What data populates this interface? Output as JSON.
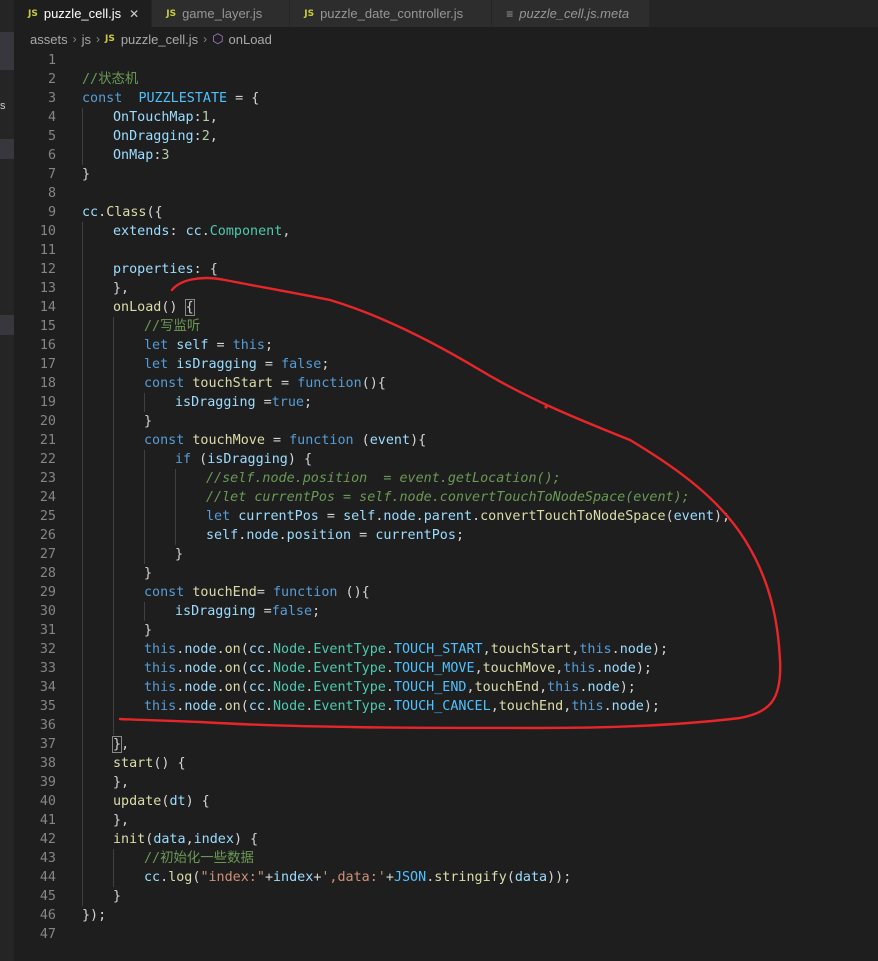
{
  "tabs": [
    {
      "label": "puzzle_cell.js",
      "badge": "JS",
      "active": true,
      "close": "✕"
    },
    {
      "label": "game_layer.js",
      "badge": "JS"
    },
    {
      "label": "puzzle_date_controller.js",
      "badge": "JS"
    },
    {
      "label": "puzzle_cell.js.meta",
      "italic": true
    }
  ],
  "breadcrumb": {
    "folder1": "assets",
    "folder2": "js",
    "badge": "JS",
    "file": "puzzle_cell.js",
    "symbol": "onLoad"
  },
  "annotation": {
    "color": "#e8262a"
  },
  "lines": [
    {
      "n": "1",
      "tokens": []
    },
    {
      "n": "2",
      "tokens": [
        [
          "cmt",
          "//状态机"
        ]
      ]
    },
    {
      "n": "3",
      "tokens": [
        [
          "kw",
          "const"
        ],
        [
          "",
          "  "
        ],
        [
          "cst",
          "PUZZLESTATE"
        ],
        [
          "",
          " = {"
        ]
      ]
    },
    {
      "n": "4",
      "indent": 1,
      "tokens": [
        [
          "var",
          "OnTouchMap"
        ],
        [
          "",
          ":"
        ],
        [
          "num",
          "1"
        ],
        [
          "",
          ","
        ]
      ]
    },
    {
      "n": "5",
      "indent": 1,
      "tokens": [
        [
          "var",
          "OnDragging"
        ],
        [
          "",
          ":"
        ],
        [
          "num",
          "2"
        ],
        [
          "",
          ","
        ]
      ]
    },
    {
      "n": "6",
      "indent": 1,
      "tokens": [
        [
          "var",
          "OnMap"
        ],
        [
          "",
          ":"
        ],
        [
          "num",
          "3"
        ]
      ]
    },
    {
      "n": "7",
      "tokens": [
        [
          "",
          "}"
        ]
      ]
    },
    {
      "n": "8",
      "tokens": []
    },
    {
      "n": "9",
      "tokens": [
        [
          "var",
          "cc"
        ],
        [
          "",
          "."
        ],
        [
          "fn",
          "Class"
        ],
        [
          "",
          "({"
        ]
      ]
    },
    {
      "n": "10",
      "indent": 1,
      "tokens": [
        [
          "var",
          "extends"
        ],
        [
          "",
          ": "
        ],
        [
          "var",
          "cc"
        ],
        [
          "",
          "."
        ],
        [
          "cls",
          "Component"
        ],
        [
          "",
          ","
        ]
      ]
    },
    {
      "n": "11",
      "indent": 1,
      "tokens": []
    },
    {
      "n": "12",
      "indent": 1,
      "tokens": [
        [
          "var",
          "properties"
        ],
        [
          "",
          ": {"
        ]
      ]
    },
    {
      "n": "13",
      "indent": 1,
      "tokens": [
        [
          "",
          "},"
        ]
      ]
    },
    {
      "n": "14",
      "indent": 1,
      "tokens": [
        [
          "fn",
          "onLoad"
        ],
        [
          "",
          "() "
        ],
        [
          "hl",
          "{"
        ]
      ]
    },
    {
      "n": "15",
      "indent": 2,
      "tokens": [
        [
          "cmt",
          "//写监听"
        ]
      ]
    },
    {
      "n": "16",
      "indent": 2,
      "tokens": [
        [
          "kw",
          "let"
        ],
        [
          "",
          " "
        ],
        [
          "var",
          "self"
        ],
        [
          "",
          " = "
        ],
        [
          "kw",
          "this"
        ],
        [
          "",
          ";"
        ]
      ]
    },
    {
      "n": "17",
      "indent": 2,
      "tokens": [
        [
          "kw",
          "let"
        ],
        [
          "",
          " "
        ],
        [
          "var",
          "isDragging"
        ],
        [
          "",
          " = "
        ],
        [
          "kw",
          "false"
        ],
        [
          "",
          ";"
        ]
      ]
    },
    {
      "n": "18",
      "indent": 2,
      "tokens": [
        [
          "kw",
          "const"
        ],
        [
          "",
          " "
        ],
        [
          "fn",
          "touchStart"
        ],
        [
          "",
          " = "
        ],
        [
          "kw",
          "function"
        ],
        [
          "",
          "(){"
        ]
      ]
    },
    {
      "n": "19",
      "indent": 3,
      "tokens": [
        [
          "var",
          "isDragging"
        ],
        [
          "",
          " ="
        ],
        [
          "kw",
          "true"
        ],
        [
          "",
          ";"
        ]
      ]
    },
    {
      "n": "20",
      "indent": 2,
      "tokens": [
        [
          "",
          "}"
        ]
      ]
    },
    {
      "n": "21",
      "indent": 2,
      "tokens": [
        [
          "kw",
          "const"
        ],
        [
          "",
          " "
        ],
        [
          "fn",
          "touchMove"
        ],
        [
          "",
          " = "
        ],
        [
          "kw",
          "function"
        ],
        [
          "",
          " ("
        ],
        [
          "var",
          "event"
        ],
        [
          "",
          "){"
        ]
      ]
    },
    {
      "n": "22",
      "indent": 3,
      "tokens": [
        [
          "kw",
          "if"
        ],
        [
          "",
          " ("
        ],
        [
          "var",
          "isDragging"
        ],
        [
          "",
          ") {"
        ]
      ]
    },
    {
      "n": "23",
      "indent": 4,
      "tokens": [
        [
          "cmt ital",
          "//self.node.position  = event.getLocation();"
        ]
      ]
    },
    {
      "n": "24",
      "indent": 4,
      "tokens": [
        [
          "cmt ital",
          "//let currentPos = self.node.convertTouchToNodeSpace(event);"
        ]
      ]
    },
    {
      "n": "25",
      "indent": 4,
      "tokens": [
        [
          "kw",
          "let"
        ],
        [
          "",
          " "
        ],
        [
          "var",
          "currentPos"
        ],
        [
          "",
          " = "
        ],
        [
          "var",
          "self"
        ],
        [
          "",
          "."
        ],
        [
          "var",
          "node"
        ],
        [
          "",
          "."
        ],
        [
          "var",
          "parent"
        ],
        [
          "",
          "."
        ],
        [
          "fn",
          "convertTouchToNodeSpace"
        ],
        [
          "",
          "("
        ],
        [
          "var",
          "event"
        ],
        [
          "",
          ");"
        ]
      ]
    },
    {
      "n": "26",
      "indent": 4,
      "tokens": [
        [
          "var",
          "self"
        ],
        [
          "",
          "."
        ],
        [
          "var",
          "node"
        ],
        [
          "",
          "."
        ],
        [
          "var",
          "position"
        ],
        [
          "",
          " = "
        ],
        [
          "var",
          "currentPos"
        ],
        [
          "",
          ";"
        ]
      ]
    },
    {
      "n": "27",
      "indent": 3,
      "tokens": [
        [
          "",
          "}"
        ]
      ]
    },
    {
      "n": "28",
      "indent": 2,
      "tokens": [
        [
          "",
          "}"
        ]
      ]
    },
    {
      "n": "29",
      "indent": 2,
      "tokens": [
        [
          "kw",
          "const"
        ],
        [
          "",
          " "
        ],
        [
          "fn",
          "touchEnd"
        ],
        [
          "",
          "= "
        ],
        [
          "kw",
          "function"
        ],
        [
          "",
          " (){"
        ]
      ]
    },
    {
      "n": "30",
      "indent": 3,
      "tokens": [
        [
          "var",
          "isDragging"
        ],
        [
          "",
          " ="
        ],
        [
          "kw",
          "false"
        ],
        [
          "",
          ";"
        ]
      ]
    },
    {
      "n": "31",
      "indent": 2,
      "tokens": [
        [
          "",
          "}"
        ]
      ]
    },
    {
      "n": "32",
      "indent": 2,
      "tokens": [
        [
          "kw",
          "this"
        ],
        [
          "",
          "."
        ],
        [
          "var",
          "node"
        ],
        [
          "",
          "."
        ],
        [
          "fn",
          "on"
        ],
        [
          "",
          "("
        ],
        [
          "var",
          "cc"
        ],
        [
          "",
          "."
        ],
        [
          "cls",
          "Node"
        ],
        [
          "",
          "."
        ],
        [
          "cls",
          "EventType"
        ],
        [
          "",
          "."
        ],
        [
          "cst",
          "TOUCH_START"
        ],
        [
          "",
          ","
        ],
        [
          "fn",
          "touchStart"
        ],
        [
          "",
          ","
        ],
        [
          "kw",
          "this"
        ],
        [
          "",
          "."
        ],
        [
          "var",
          "node"
        ],
        [
          "",
          ");"
        ]
      ]
    },
    {
      "n": "33",
      "indent": 2,
      "tokens": [
        [
          "kw",
          "this"
        ],
        [
          "",
          "."
        ],
        [
          "var",
          "node"
        ],
        [
          "",
          "."
        ],
        [
          "fn",
          "on"
        ],
        [
          "",
          "("
        ],
        [
          "var",
          "cc"
        ],
        [
          "",
          "."
        ],
        [
          "cls",
          "Node"
        ],
        [
          "",
          "."
        ],
        [
          "cls",
          "EventType"
        ],
        [
          "",
          "."
        ],
        [
          "cst",
          "TOUCH_MOVE"
        ],
        [
          "",
          ","
        ],
        [
          "fn",
          "touchMove"
        ],
        [
          "",
          ","
        ],
        [
          "kw",
          "this"
        ],
        [
          "",
          "."
        ],
        [
          "var",
          "node"
        ],
        [
          "",
          ");"
        ]
      ]
    },
    {
      "n": "34",
      "indent": 2,
      "tokens": [
        [
          "kw",
          "this"
        ],
        [
          "",
          "."
        ],
        [
          "var",
          "node"
        ],
        [
          "",
          "."
        ],
        [
          "fn",
          "on"
        ],
        [
          "",
          "("
        ],
        [
          "var",
          "cc"
        ],
        [
          "",
          "."
        ],
        [
          "cls",
          "Node"
        ],
        [
          "",
          "."
        ],
        [
          "cls",
          "EventType"
        ],
        [
          "",
          "."
        ],
        [
          "cst",
          "TOUCH_END"
        ],
        [
          "",
          ","
        ],
        [
          "fn",
          "touchEnd"
        ],
        [
          "",
          ","
        ],
        [
          "kw",
          "this"
        ],
        [
          "",
          "."
        ],
        [
          "var",
          "node"
        ],
        [
          "",
          ");"
        ]
      ]
    },
    {
      "n": "35",
      "indent": 2,
      "tokens": [
        [
          "kw",
          "this"
        ],
        [
          "",
          "."
        ],
        [
          "var",
          "node"
        ],
        [
          "",
          "."
        ],
        [
          "fn",
          "on"
        ],
        [
          "",
          "("
        ],
        [
          "var",
          "cc"
        ],
        [
          "",
          "."
        ],
        [
          "cls",
          "Node"
        ],
        [
          "",
          "."
        ],
        [
          "cls",
          "EventType"
        ],
        [
          "",
          "."
        ],
        [
          "cst",
          "TOUCH_CANCEL"
        ],
        [
          "",
          ","
        ],
        [
          "fn",
          "touchEnd"
        ],
        [
          "",
          ","
        ],
        [
          "kw",
          "this"
        ],
        [
          "",
          "."
        ],
        [
          "var",
          "node"
        ],
        [
          "",
          ");"
        ]
      ]
    },
    {
      "n": "36",
      "indent": 2,
      "tokens": []
    },
    {
      "n": "37",
      "indent": 1,
      "tokens": [
        [
          "hl",
          "}"
        ],
        [
          "",
          ","
        ]
      ]
    },
    {
      "n": "38",
      "indent": 1,
      "tokens": [
        [
          "fn",
          "start"
        ],
        [
          "",
          "() {"
        ]
      ]
    },
    {
      "n": "39",
      "indent": 1,
      "tokens": [
        [
          "",
          "},"
        ]
      ]
    },
    {
      "n": "40",
      "indent": 1,
      "tokens": [
        [
          "fn",
          "update"
        ],
        [
          "",
          "("
        ],
        [
          "var",
          "dt"
        ],
        [
          "",
          ") {"
        ]
      ]
    },
    {
      "n": "41",
      "indent": 1,
      "tokens": [
        [
          "",
          "},"
        ]
      ]
    },
    {
      "n": "42",
      "indent": 1,
      "tokens": [
        [
          "fn",
          "init"
        ],
        [
          "",
          "("
        ],
        [
          "var",
          "data"
        ],
        [
          "",
          ","
        ],
        [
          "var",
          "index"
        ],
        [
          "",
          ") {"
        ]
      ]
    },
    {
      "n": "43",
      "indent": 2,
      "tokens": [
        [
          "cmt",
          "//初始化一些数据"
        ]
      ]
    },
    {
      "n": "44",
      "indent": 2,
      "tokens": [
        [
          "var",
          "cc"
        ],
        [
          "",
          "."
        ],
        [
          "fn",
          "log"
        ],
        [
          "",
          "("
        ],
        [
          "str",
          "\"index:\""
        ],
        [
          "",
          "+"
        ],
        [
          "var",
          "index"
        ],
        [
          "",
          "+"
        ],
        [
          "str",
          "',data:'"
        ],
        [
          "",
          "+"
        ],
        [
          "cst",
          "JSON"
        ],
        [
          "",
          "."
        ],
        [
          "fn",
          "stringify"
        ],
        [
          "",
          "("
        ],
        [
          "var",
          "data"
        ],
        [
          "",
          "));"
        ]
      ]
    },
    {
      "n": "45",
      "indent": 1,
      "tokens": [
        [
          "",
          "}"
        ]
      ]
    },
    {
      "n": "46",
      "tokens": [
        [
          "",
          "});"
        ]
      ]
    },
    {
      "n": "47",
      "tokens": []
    }
  ]
}
